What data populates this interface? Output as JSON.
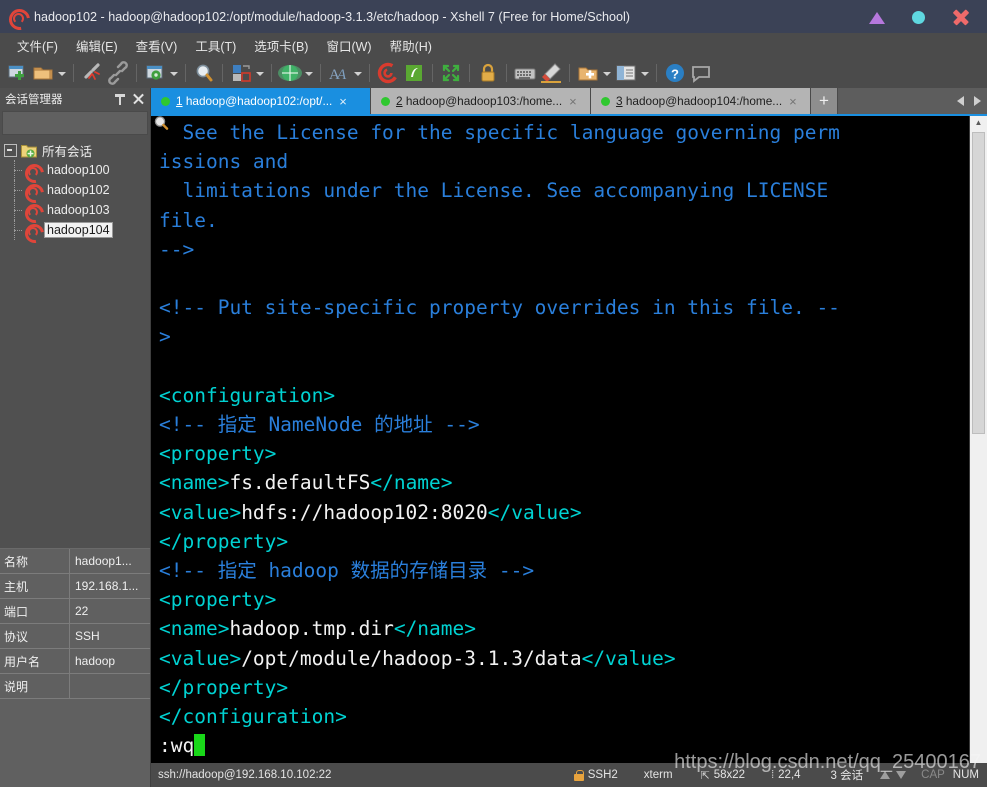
{
  "window": {
    "title": "hadoop102 - hadoop@hadoop102:/opt/module/hadoop-3.1.3/etc/hadoop - Xshell 7 (Free for Home/School)",
    "logo_icon": "xshell-spiral-icon",
    "controls": {
      "minimize_icon": "triangle-minimize-icon",
      "maximize_icon": "circle-maximize-icon",
      "close_icon": "x-close-icon"
    }
  },
  "menubar": {
    "items": [
      {
        "label": "文件(F)",
        "name": "menu-file"
      },
      {
        "label": "编辑(E)",
        "name": "menu-edit"
      },
      {
        "label": "查看(V)",
        "name": "menu-view"
      },
      {
        "label": "工具(T)",
        "name": "menu-tools"
      },
      {
        "label": "选项卡(B)",
        "name": "menu-tabs"
      },
      {
        "label": "窗口(W)",
        "name": "menu-window"
      },
      {
        "label": "帮助(H)",
        "name": "menu-help"
      }
    ]
  },
  "toolbar": {
    "icons": [
      "new-session-icon",
      "open-folder-icon",
      "disconnect-icon",
      "link-icon",
      "session-properties-icon",
      "find-icon",
      "layout-icon",
      "globe-icon",
      "font-icon",
      "xshell-icon",
      "xftp-icon",
      "fullscreen-icon",
      "lock-icon",
      "keyboard-icon",
      "highlight-icon",
      "add-folder-icon",
      "split-view-icon",
      "help-icon",
      "chat-icon"
    ]
  },
  "sidebar": {
    "title": "会话管理器",
    "pin_icon": "pin-icon",
    "close_icon": "close-icon",
    "search": {
      "value": "",
      "placeholder": "",
      "icon": "search-icon"
    },
    "tree": {
      "root": {
        "label": "所有会话",
        "icon": "folder-icon",
        "expander": "collapse-icon"
      },
      "children": [
        {
          "label": "hadoop100",
          "icon": "session-icon",
          "selected": false
        },
        {
          "label": "hadoop102",
          "icon": "session-icon",
          "selected": false
        },
        {
          "label": "hadoop103",
          "icon": "session-icon",
          "selected": false
        },
        {
          "label": "hadoop104",
          "icon": "session-icon",
          "selected": true
        }
      ]
    },
    "properties": [
      {
        "key": "名称",
        "value": "hadoop1..."
      },
      {
        "key": "主机",
        "value": "192.168.1..."
      },
      {
        "key": "端口",
        "value": "22"
      },
      {
        "key": "协议",
        "value": "SSH"
      },
      {
        "key": "用户名",
        "value": "hadoop"
      },
      {
        "key": "说明",
        "value": ""
      }
    ]
  },
  "tabs": {
    "items": [
      {
        "index": "1",
        "label": " hadoop@hadoop102:/opt/...",
        "active": true,
        "status": "connected"
      },
      {
        "index": "2",
        "label": " hadoop@hadoop103:/home...",
        "active": false,
        "status": "connected"
      },
      {
        "index": "3",
        "label": " hadoop@hadoop104:/home...",
        "active": false,
        "status": "connected"
      }
    ],
    "add_label": "+",
    "nav_prev_icon": "chevron-left-icon",
    "nav_next_icon": "chevron-right-icon"
  },
  "terminal": {
    "lines": [
      [
        {
          "t": "  See the License for the specific language governing perm",
          "c": "comment"
        }
      ],
      [
        {
          "t": "issions and",
          "c": "comment"
        }
      ],
      [
        {
          "t": "  limitations under the License. See accompanying LICENSE",
          "c": "comment"
        }
      ],
      [
        {
          "t": "file.",
          "c": "comment"
        }
      ],
      [
        {
          "t": "-->",
          "c": "comment"
        }
      ],
      [
        {
          "t": "",
          "c": "text"
        }
      ],
      [
        {
          "t": "<!-- Put site-specific property overrides in this file. --",
          "c": "comment"
        }
      ],
      [
        {
          "t": ">",
          "c": "comment"
        }
      ],
      [
        {
          "t": "",
          "c": "text"
        }
      ],
      [
        {
          "t": "<configuration>",
          "c": "tag"
        }
      ],
      [
        {
          "t": "<!-- 指定 NameNode 的地址 -->",
          "c": "comment"
        }
      ],
      [
        {
          "t": "<property>",
          "c": "tag"
        }
      ],
      [
        {
          "t": "<name>",
          "c": "tag"
        },
        {
          "t": "fs.defaultFS",
          "c": "text"
        },
        {
          "t": "</name>",
          "c": "tag"
        }
      ],
      [
        {
          "t": "<value>",
          "c": "tag"
        },
        {
          "t": "hdfs://hadoop102:8020",
          "c": "text"
        },
        {
          "t": "</value>",
          "c": "tag"
        }
      ],
      [
        {
          "t": "</property>",
          "c": "tag"
        }
      ],
      [
        {
          "t": "<!-- 指定 hadoop 数据的存储目录 -->",
          "c": "comment"
        }
      ],
      [
        {
          "t": "<property>",
          "c": "tag"
        }
      ],
      [
        {
          "t": "<name>",
          "c": "tag"
        },
        {
          "t": "hadoop.tmp.dir",
          "c": "text"
        },
        {
          "t": "</name>",
          "c": "tag"
        }
      ],
      [
        {
          "t": "<value>",
          "c": "tag"
        },
        {
          "t": "/opt/module/hadoop-3.1.3/data",
          "c": "text"
        },
        {
          "t": "</value>",
          "c": "tag"
        }
      ],
      [
        {
          "t": "</property>",
          "c": "tag"
        }
      ],
      [
        {
          "t": "</configuration>",
          "c": "tag"
        }
      ],
      [
        {
          "t": ":wq",
          "c": "text"
        },
        {
          "t": "",
          "c": "cursor"
        }
      ]
    ],
    "scrollbar": {
      "up_icon": "scroll-up-icon",
      "down_icon": "scroll-down-icon"
    }
  },
  "statusbar": {
    "connection": "ssh://hadoop@192.168.10.102:22",
    "security": "SSH2",
    "security_icon": "lock-icon",
    "terminal_type": "xterm",
    "size_icon": "resize-icon",
    "size": "58x22",
    "position_icon": "cursor-position-icon",
    "position": "22,4",
    "sessions": "3 会话",
    "transfer_up_icon": "upload-arrow-icon",
    "transfer_down_icon": "download-arrow-icon",
    "caps": "CAP",
    "num": "NUM"
  },
  "watermark": {
    "text": "https://blog.csdn.net/qq_25400167"
  },
  "colors": {
    "titlebar": "#3b4256",
    "chrome": "#4b4b4b",
    "sidebar": "#505050",
    "accent_tab": "#1a8fe0",
    "terminal_bg": "#000000",
    "comment": "#2a7fdb",
    "tag": "#00d2d2",
    "text": "#f2f2f2",
    "cursor": "#19d819",
    "session_red": "#e0453a",
    "status_green": "#2fc82f"
  }
}
